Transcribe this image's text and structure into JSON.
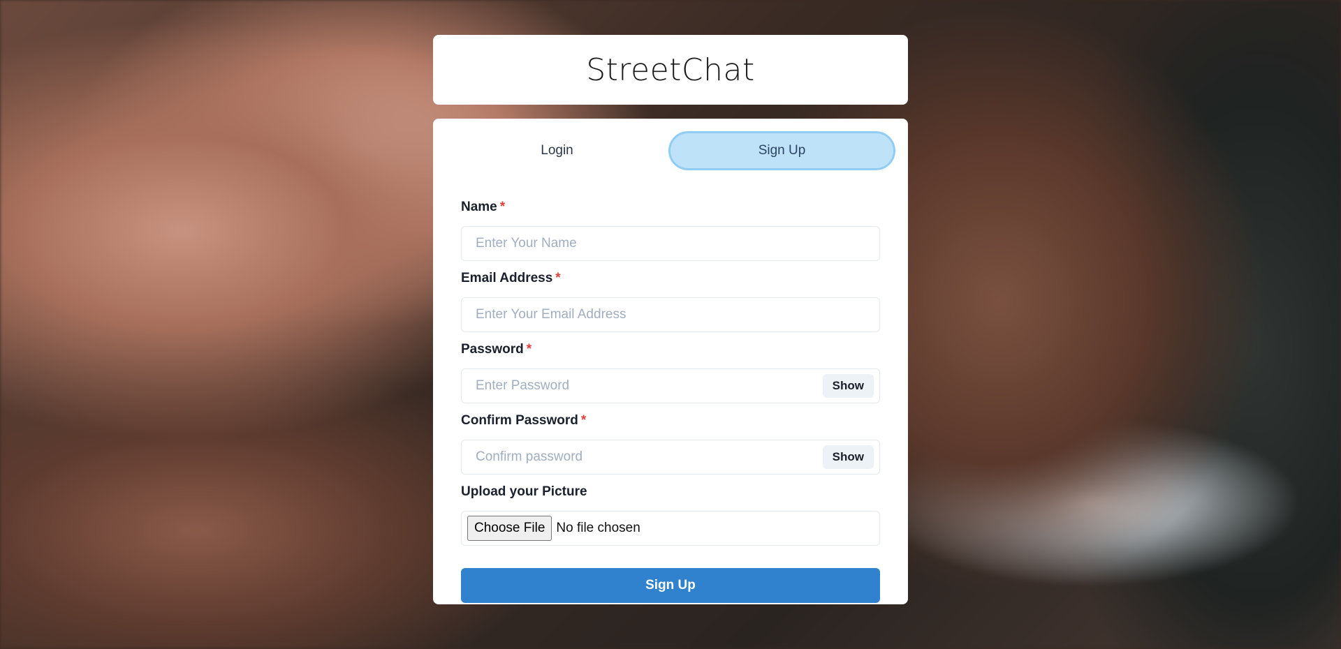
{
  "app": {
    "title": "StreetChat"
  },
  "tabs": [
    {
      "label": "Login",
      "active": false
    },
    {
      "label": "Sign Up",
      "active": true
    }
  ],
  "form": {
    "name": {
      "label": "Name",
      "required_mark": "*",
      "placeholder": "Enter Your Name",
      "value": ""
    },
    "email": {
      "label": "Email Address",
      "required_mark": "*",
      "placeholder": "Enter Your Email Address",
      "value": ""
    },
    "password": {
      "label": "Password",
      "required_mark": "*",
      "placeholder": "Enter Password",
      "value": "",
      "toggle_label": "Show"
    },
    "confirm_password": {
      "label": "Confirm Password",
      "required_mark": "*",
      "placeholder": "Confirm password",
      "value": "",
      "toggle_label": "Show"
    },
    "picture": {
      "label": "Upload your Picture",
      "button_label": "Choose File",
      "status": "No file chosen"
    },
    "submit_label": "Sign Up"
  },
  "colors": {
    "primary": "#3182ce",
    "active_tab_bg": "#bee3f8",
    "active_tab_border": "#90cdf4",
    "required": "#e53e3e"
  }
}
